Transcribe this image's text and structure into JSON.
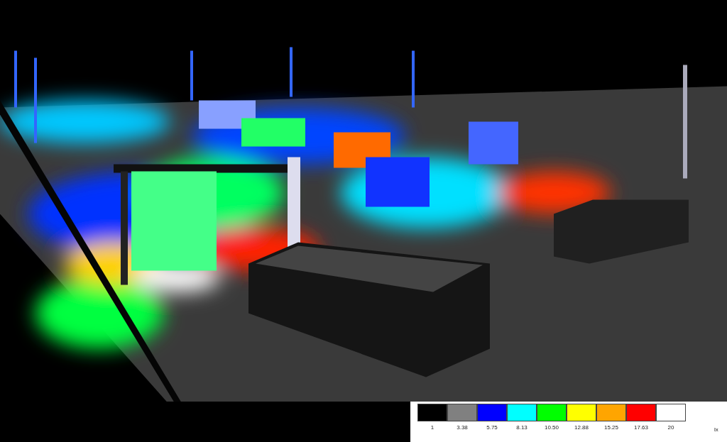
{
  "legend": {
    "unit": "lx",
    "items": [
      {
        "label": "1",
        "color": "#000000"
      },
      {
        "label": "3.38",
        "color": "#808080"
      },
      {
        "label": "5.75",
        "color": "#0000ff"
      },
      {
        "label": "8.13",
        "color": "#00ffff"
      },
      {
        "label": "10.50",
        "color": "#00ff00"
      },
      {
        "label": "12.88",
        "color": "#ffff00"
      },
      {
        "label": "15.25",
        "color": "#ffa500"
      },
      {
        "label": "17.63",
        "color": "#ff0000"
      },
      {
        "label": "20",
        "color": "#ffffff"
      }
    ]
  }
}
